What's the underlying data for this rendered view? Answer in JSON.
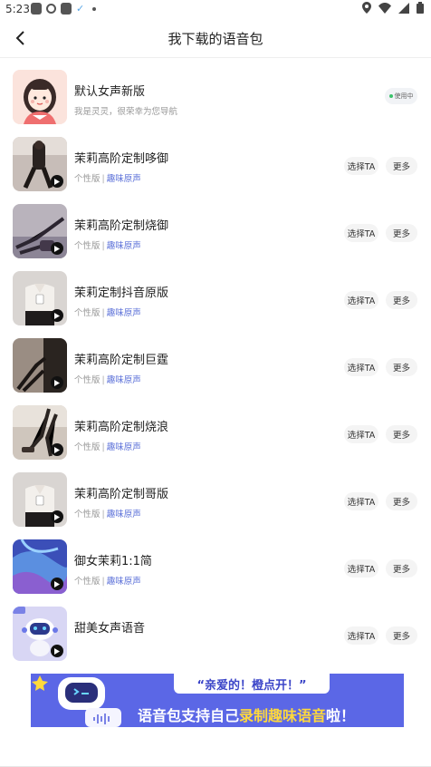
{
  "status_bar": {
    "time": "5:23"
  },
  "header": {
    "title": "我下载的语音包"
  },
  "items": [
    {
      "name": "默认女声新版",
      "desc": "我是灵灵，很荣幸为您导航",
      "in_use_label": "使用中",
      "thumb": "avatar"
    },
    {
      "name": "茉莉高阶定制哆御",
      "tag": "个性版",
      "category": "趣味原声",
      "select_label": "选择TA",
      "more_label": "更多",
      "thumb": "photo"
    },
    {
      "name": "茉莉高阶定制烧御",
      "tag": "个性版",
      "category": "趣味原声",
      "select_label": "选择TA",
      "more_label": "更多",
      "thumb": "photo"
    },
    {
      "name": "茉莉定制抖音原版",
      "tag": "个性版",
      "category": "趣味原声",
      "select_label": "选择TA",
      "more_label": "更多",
      "thumb": "photo"
    },
    {
      "name": "茉莉高阶定制巨霆",
      "tag": "个性版",
      "category": "趣味原声",
      "select_label": "选择TA",
      "more_label": "更多",
      "thumb": "photo"
    },
    {
      "name": "茉莉高阶定制烧浪",
      "tag": "个性版",
      "category": "趣味原声",
      "select_label": "选择TA",
      "more_label": "更多",
      "thumb": "photo"
    },
    {
      "name": "茉莉高阶定制哥版",
      "tag": "个性版",
      "category": "趣味原声",
      "select_label": "选择TA",
      "more_label": "更多",
      "thumb": "photo"
    },
    {
      "name": "御女茉莉1:1简",
      "tag": "个性版",
      "category": "趣味原声",
      "select_label": "选择TA",
      "more_label": "更多",
      "thumb": "abstract"
    },
    {
      "name": "甜美女声语音",
      "select_label": "选择TA",
      "more_label": "更多",
      "thumb": "robot"
    }
  ],
  "banner": {
    "quote": "“亲爱的！橙点开！”",
    "line_part1": "语音包支持自己",
    "line_highlight": "录制趣味语音",
    "line_part2": "啦！"
  },
  "colors": {
    "accent": "#5a6fd8",
    "banner_bg": "#5b67e6",
    "highlight": "#ffd93b",
    "in_use_dot": "#3bc26b"
  }
}
